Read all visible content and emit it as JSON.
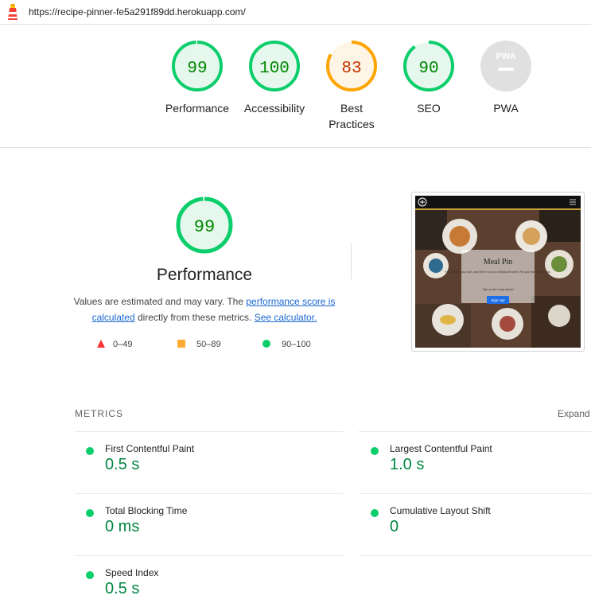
{
  "url": "https://recipe-pinner-fe5a291f89dd.herokuapp.com/",
  "gauges": [
    {
      "label": "Performance",
      "score": "99",
      "value": 99,
      "status": "pass"
    },
    {
      "label": "Accessibility",
      "score": "100",
      "value": 100,
      "status": "pass"
    },
    {
      "label": "Best Practices",
      "score": "83",
      "value": 83,
      "status": "average"
    },
    {
      "label": "SEO",
      "score": "90",
      "value": 90,
      "status": "pass"
    },
    {
      "label": "PWA",
      "badge": "PWA",
      "status": "na"
    }
  ],
  "performance": {
    "score": "99",
    "value": 99,
    "title": "Performance",
    "desc_prefix": "Values are estimated and may vary. The ",
    "link1": "performance score is calculated",
    "desc_middle": " directly from these metrics. ",
    "link2": "See calculator."
  },
  "legend": [
    {
      "range": "0–49",
      "icon": "triangle-icon",
      "color": "#ff3333"
    },
    {
      "range": "50–89",
      "icon": "square-icon",
      "color": "#ffaa33"
    },
    {
      "range": "90–100",
      "icon": "circle-icon",
      "color": "#0cce6b"
    }
  ],
  "screenshot": {
    "title": "Meal Pin",
    "text": "Find recipes you love, and never run out of ideas at home. Pin your favourite meals.",
    "small_text": "Sign up free to get started",
    "button": "Sign Up!"
  },
  "metrics": {
    "heading": "METRICS",
    "expand": "Expand view",
    "items": [
      {
        "name": "First Contentful Paint",
        "value": "0.5 s"
      },
      {
        "name": "Largest Contentful Paint",
        "value": "1.0 s"
      },
      {
        "name": "Total Blocking Time",
        "value": "0 ms"
      },
      {
        "name": "Cumulative Layout Shift",
        "value": "0"
      },
      {
        "name": "Speed Index",
        "value": "0.5 s"
      }
    ]
  },
  "colors": {
    "pass": "#0cce6b",
    "pass_text": "#008800",
    "pass_bg": "#e6f8ee",
    "average": "#ffa400",
    "average_text": "#c33300",
    "average_bg": "#fff5e6",
    "na": "#e0e0e0"
  }
}
